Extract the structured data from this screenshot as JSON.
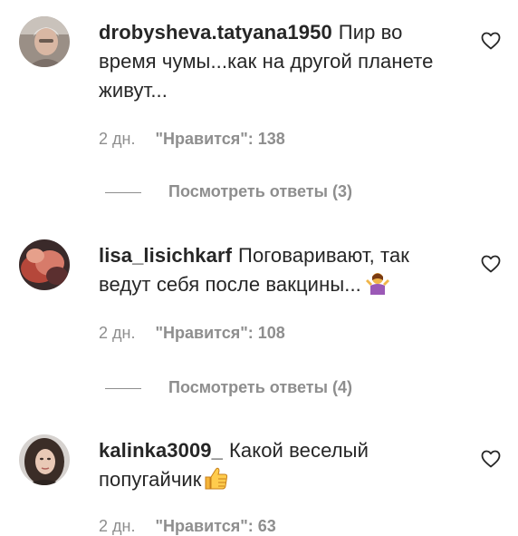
{
  "comments": [
    {
      "username": "drobysheva.tatyana1950",
      "text": "Пир во время чумы...как на другой планете живут...",
      "time": "2 дн.",
      "likes": "\"Нравится\": 138",
      "replies": "Посмотреть ответы (3)"
    },
    {
      "username": "lisa_lisichkarf",
      "text": "Поговаривают, так ведут себя после вакцины...",
      "time": "2 дн.",
      "likes": "\"Нравится\": 108",
      "replies": "Посмотреть ответы (4)",
      "emoji": "person-shrugging-emoji"
    },
    {
      "username": "kalinka3009_",
      "text": "Какой веселый попугайчик",
      "time": "2 дн.",
      "likes": "\"Нравится\": 63",
      "emoji": "thumbs-up-emoji"
    }
  ],
  "icons": {
    "heart": "heart-outline-icon"
  },
  "colors": {
    "text": "#262626",
    "secondary": "#8e8e8e",
    "background": "#ffffff"
  }
}
